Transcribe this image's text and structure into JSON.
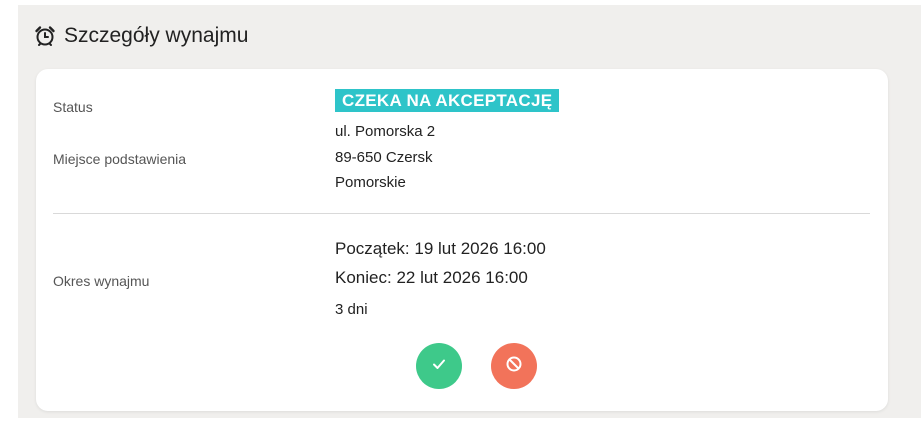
{
  "section": {
    "title": "Szczegóły wynajmu",
    "icon": "alarm-clock-icon"
  },
  "status": {
    "label": "Status",
    "value": "CZEKA NA AKCEPTACJĘ",
    "color": "#2ec4c9"
  },
  "location": {
    "label": "Miejsce podstawienia",
    "street": "ul. Pomorska 2",
    "city": "89-650 Czersk",
    "region": "Pomorskie"
  },
  "period": {
    "label": "Okres wynajmu",
    "start_label": "Początek:",
    "start": "19 lut 2026 16:00",
    "end_label": "Koniec:",
    "end": "22 lut 2026 16:00",
    "duration": "3 dni"
  },
  "actions": {
    "accept_icon": "checkmark-icon",
    "accept_color": "#3ec98a",
    "reject_icon": "prohibited-icon",
    "reject_color": "#f2735a"
  }
}
